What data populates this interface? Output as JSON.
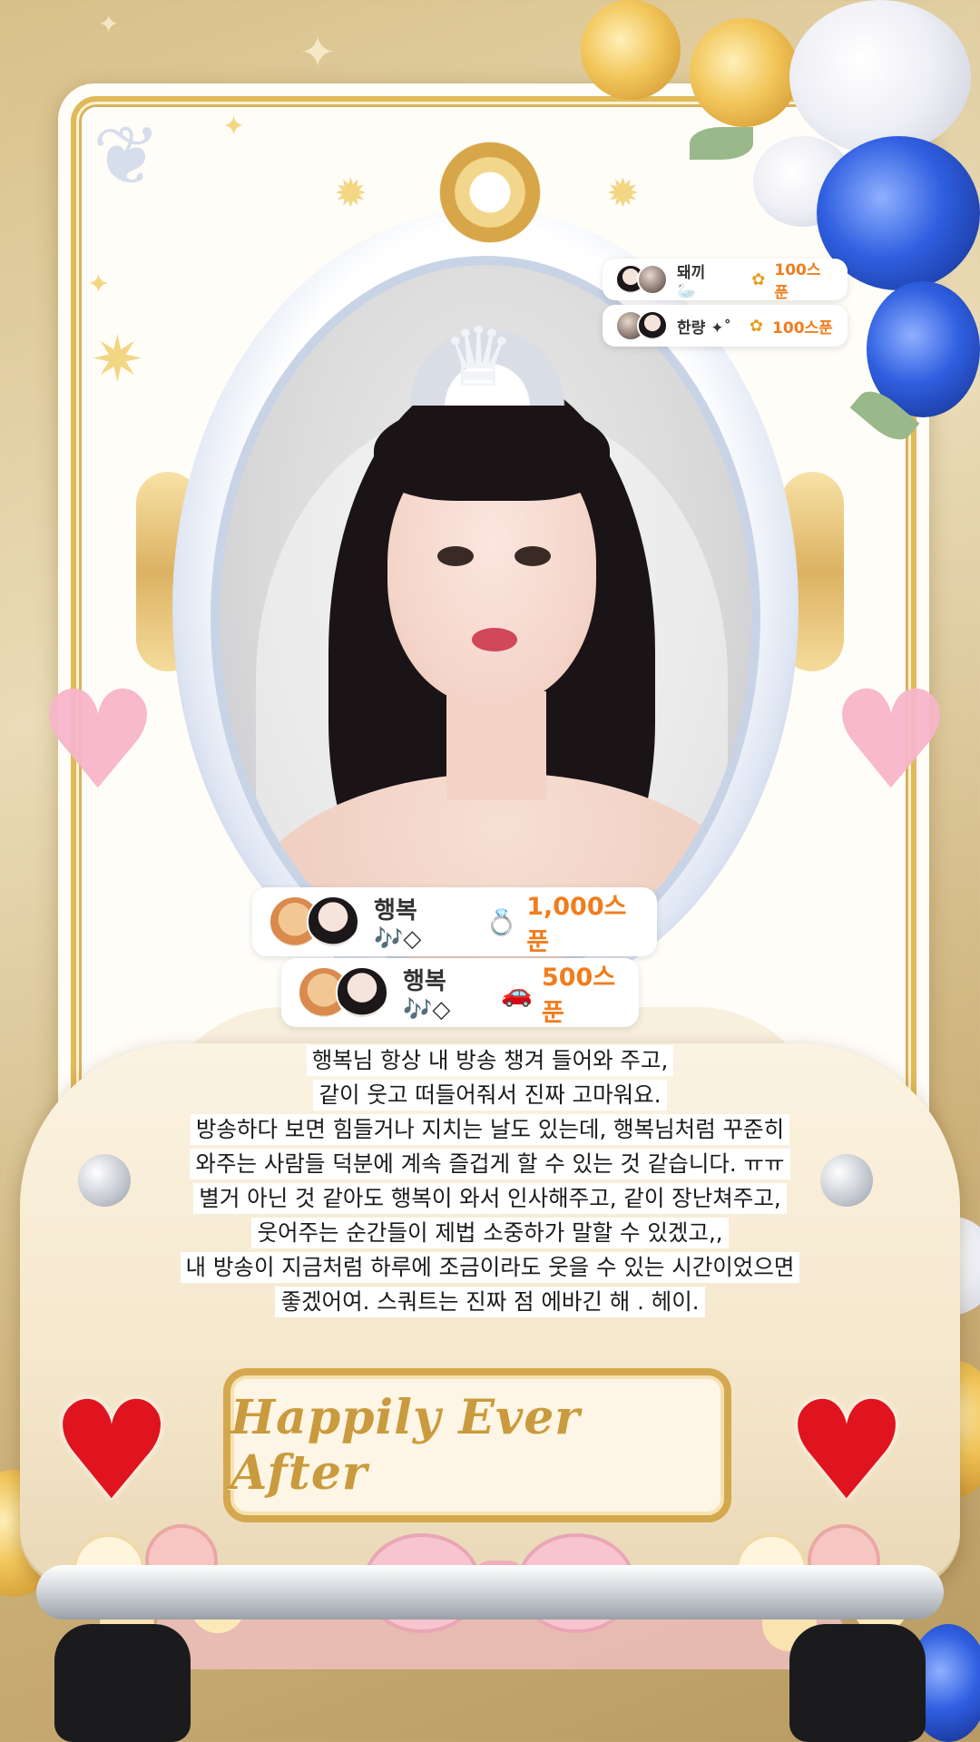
{
  "gift_feed": {
    "top": [
      {
        "name": "돼끼 🦢",
        "gift_icon": "spoon-gift-icon",
        "amount": "100스푼"
      },
      {
        "name": "한량 ✦˚",
        "gift_icon": "spoon-gift-icon",
        "amount": "100스푼"
      }
    ],
    "center": [
      {
        "name": "행복🎶◇",
        "gift_icon": "ring-gift-icon",
        "amount": "1,000스푼"
      },
      {
        "name": "행복🎶◇",
        "gift_icon": "wedding-car-gift-icon",
        "amount": "500스푼"
      }
    ]
  },
  "message": {
    "lines": [
      "행복님 항상 내 방송 챙겨 들어와 주고,",
      "같이 웃고 떠들어줘서 진짜 고마워요.",
      "방송하다 보면 힘들거나 지치는 날도 있는데, 행복님처럼 꾸준히",
      "와주는 사람들 덕분에 계속 즐겁게 할 수 있는 것 같습니다. ㅠㅠ",
      "별거 아닌 것 같아도 행복이 와서 인사해주고, 같이 장난쳐주고,",
      "웃어주는 순간들이 제법 소중하가 말할 수 있겠고,,",
      "내 방송이 지금처럼 하루에 조금이라도 웃을 수 있는 시간이었으면",
      "좋겠어여. 스쿼트는 진짜 점 에바긴 해 . 헤이."
    ]
  },
  "plaque": {
    "text": "Happily Ever After"
  },
  "colors": {
    "amount": "#f07d1e",
    "frame_gold": "#e0b95a",
    "heart_red": "#e0141f",
    "heart_pink": "#f7b6c9"
  }
}
